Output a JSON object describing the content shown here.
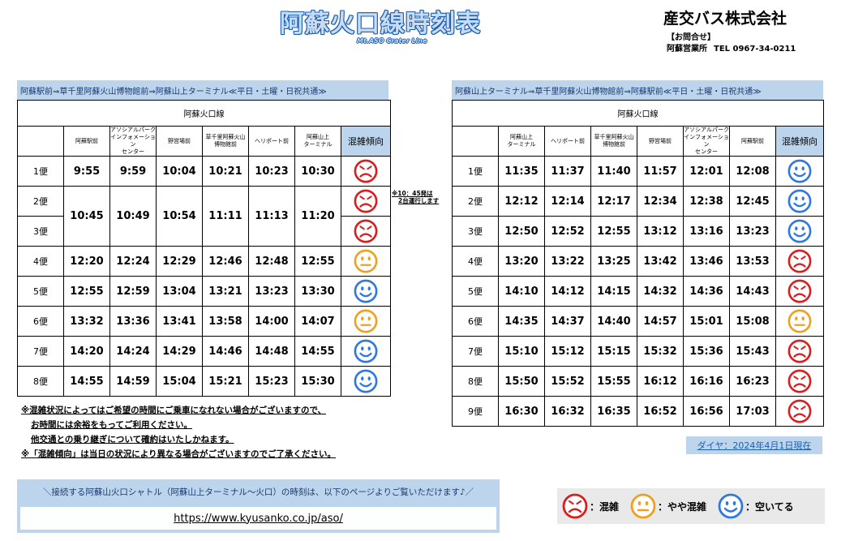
{
  "header": {
    "title": "阿蘇火口線時刻表",
    "subtitle": "Mt.ASO Crater Line",
    "company": "産交バス株式会社",
    "inquiry_label": "【お問合せ】",
    "office": "阿蘇営業所",
    "tel": "TEL 0967-34-0211"
  },
  "colors": {
    "crowded": "#d81e1e",
    "moderate": "#f0a020",
    "vacant": "#2f78e0",
    "accent": "#bcd5ec"
  },
  "left": {
    "route": "阿蘇駅前⇒草千里阿蘇火山博物館前⇒阿蘇山上ターミナル≪平日・土曜・日祝共通≫",
    "line_name": "阿蘇火口線",
    "stops": [
      "阿蘇駅前",
      "アソシアルパーク\nインフォメーション\nセンター",
      "野営場前",
      "草千里阿蘇火山\n博物館前",
      "ヘリポート前",
      "阿蘇山上\nターミナル"
    ],
    "congestion_header": "混雑傾向",
    "rows": [
      {
        "bin": "1便",
        "times": [
          "9:55",
          "9:59",
          "10:04",
          "10:21",
          "10:23",
          "10:30"
        ],
        "cong": "crowded-icon"
      },
      {
        "bin": "2便",
        "times": [
          "10:45",
          "10:49",
          "10:54",
          "11:11",
          "11:13",
          "11:20"
        ],
        "cong": "crowded-icon"
      },
      {
        "bin": "3便",
        "times": [],
        "cong": "crowded-icon"
      },
      {
        "bin": "4便",
        "times": [
          "12:20",
          "12:24",
          "12:29",
          "12:46",
          "12:48",
          "12:55"
        ],
        "cong": "moderate-icon"
      },
      {
        "bin": "5便",
        "times": [
          "12:55",
          "12:59",
          "13:04",
          "13:21",
          "13:23",
          "13:30"
        ],
        "cong": "vacant-icon"
      },
      {
        "bin": "6便",
        "times": [
          "13:32",
          "13:36",
          "13:41",
          "13:58",
          "14:00",
          "14:07"
        ],
        "cong": "moderate-icon"
      },
      {
        "bin": "7便",
        "times": [
          "14:20",
          "14:24",
          "14:29",
          "14:46",
          "14:48",
          "14:55"
        ],
        "cong": "vacant-icon"
      },
      {
        "bin": "8便",
        "times": [
          "14:55",
          "14:59",
          "15:04",
          "15:21",
          "15:23",
          "15:30"
        ],
        "cong": "vacant-icon"
      }
    ]
  },
  "right": {
    "route": "阿蘇山上ターミナル⇒草千里阿蘇火山博物館前⇒阿蘇駅前≪平日・土曜・日祝共通≫",
    "line_name": "阿蘇火口線",
    "stops": [
      "阿蘇山上\nターミナル",
      "ヘリポート前",
      "草千里阿蘇火山\n博物館前",
      "野営場前",
      "アソシアルパーク\nインフォメーション\nセンター",
      "阿蘇駅前"
    ],
    "congestion_header": "混雑傾向",
    "rows": [
      {
        "bin": "1便",
        "times": [
          "11:35",
          "11:37",
          "11:40",
          "11:57",
          "12:01",
          "12:08"
        ],
        "cong": "vacant-icon"
      },
      {
        "bin": "2便",
        "times": [
          "12:12",
          "12:14",
          "12:17",
          "12:34",
          "12:38",
          "12:45"
        ],
        "cong": "vacant-icon"
      },
      {
        "bin": "3便",
        "times": [
          "12:50",
          "12:52",
          "12:55",
          "13:12",
          "13:16",
          "13:23"
        ],
        "cong": "vacant-icon"
      },
      {
        "bin": "4便",
        "times": [
          "13:20",
          "13:22",
          "13:25",
          "13:42",
          "13:46",
          "13:53"
        ],
        "cong": "crowded-icon"
      },
      {
        "bin": "5便",
        "times": [
          "14:10",
          "14:12",
          "14:15",
          "14:32",
          "14:36",
          "14:43"
        ],
        "cong": "crowded-icon"
      },
      {
        "bin": "6便",
        "times": [
          "14:35",
          "14:37",
          "14:40",
          "14:57",
          "15:01",
          "15:08"
        ],
        "cong": "moderate-icon"
      },
      {
        "bin": "7便",
        "times": [
          "15:10",
          "15:12",
          "15:15",
          "15:32",
          "15:36",
          "15:43"
        ],
        "cong": "crowded-icon"
      },
      {
        "bin": "8便",
        "times": [
          "15:50",
          "15:52",
          "15:55",
          "16:12",
          "16:16",
          "16:23"
        ],
        "cong": "crowded-icon"
      },
      {
        "bin": "9便",
        "times": [
          "16:30",
          "16:32",
          "16:35",
          "16:52",
          "16:56",
          "17:03"
        ],
        "cong": "crowded-icon"
      }
    ]
  },
  "side_note": [
    "※10：45発は",
    "2台運行します"
  ],
  "notes": [
    "※混雑状況によってはご希望の時間にご乗車になれない場合がございますので、",
    "お時間には余裕をもってご利用ください。",
    "他交通との乗り継ぎについて確約はいたしかねます。",
    "※「混雑傾向」は当日の状況により異なる場合がございますのでご了承ください。"
  ],
  "dia": "ダイヤ：2024年4月1日現在",
  "shuttle": {
    "text": "＼接続する阿蘇山火口シャトル（阿蘇山上ターミナル～火口）の時刻は、以下のページよりご覧いただけます♪／",
    "url": "https://www.kyusanko.co.jp/aso/"
  },
  "legend": {
    "crowded": "：混雑",
    "moderate": "：やや混雑",
    "vacant": "：空いてる"
  }
}
